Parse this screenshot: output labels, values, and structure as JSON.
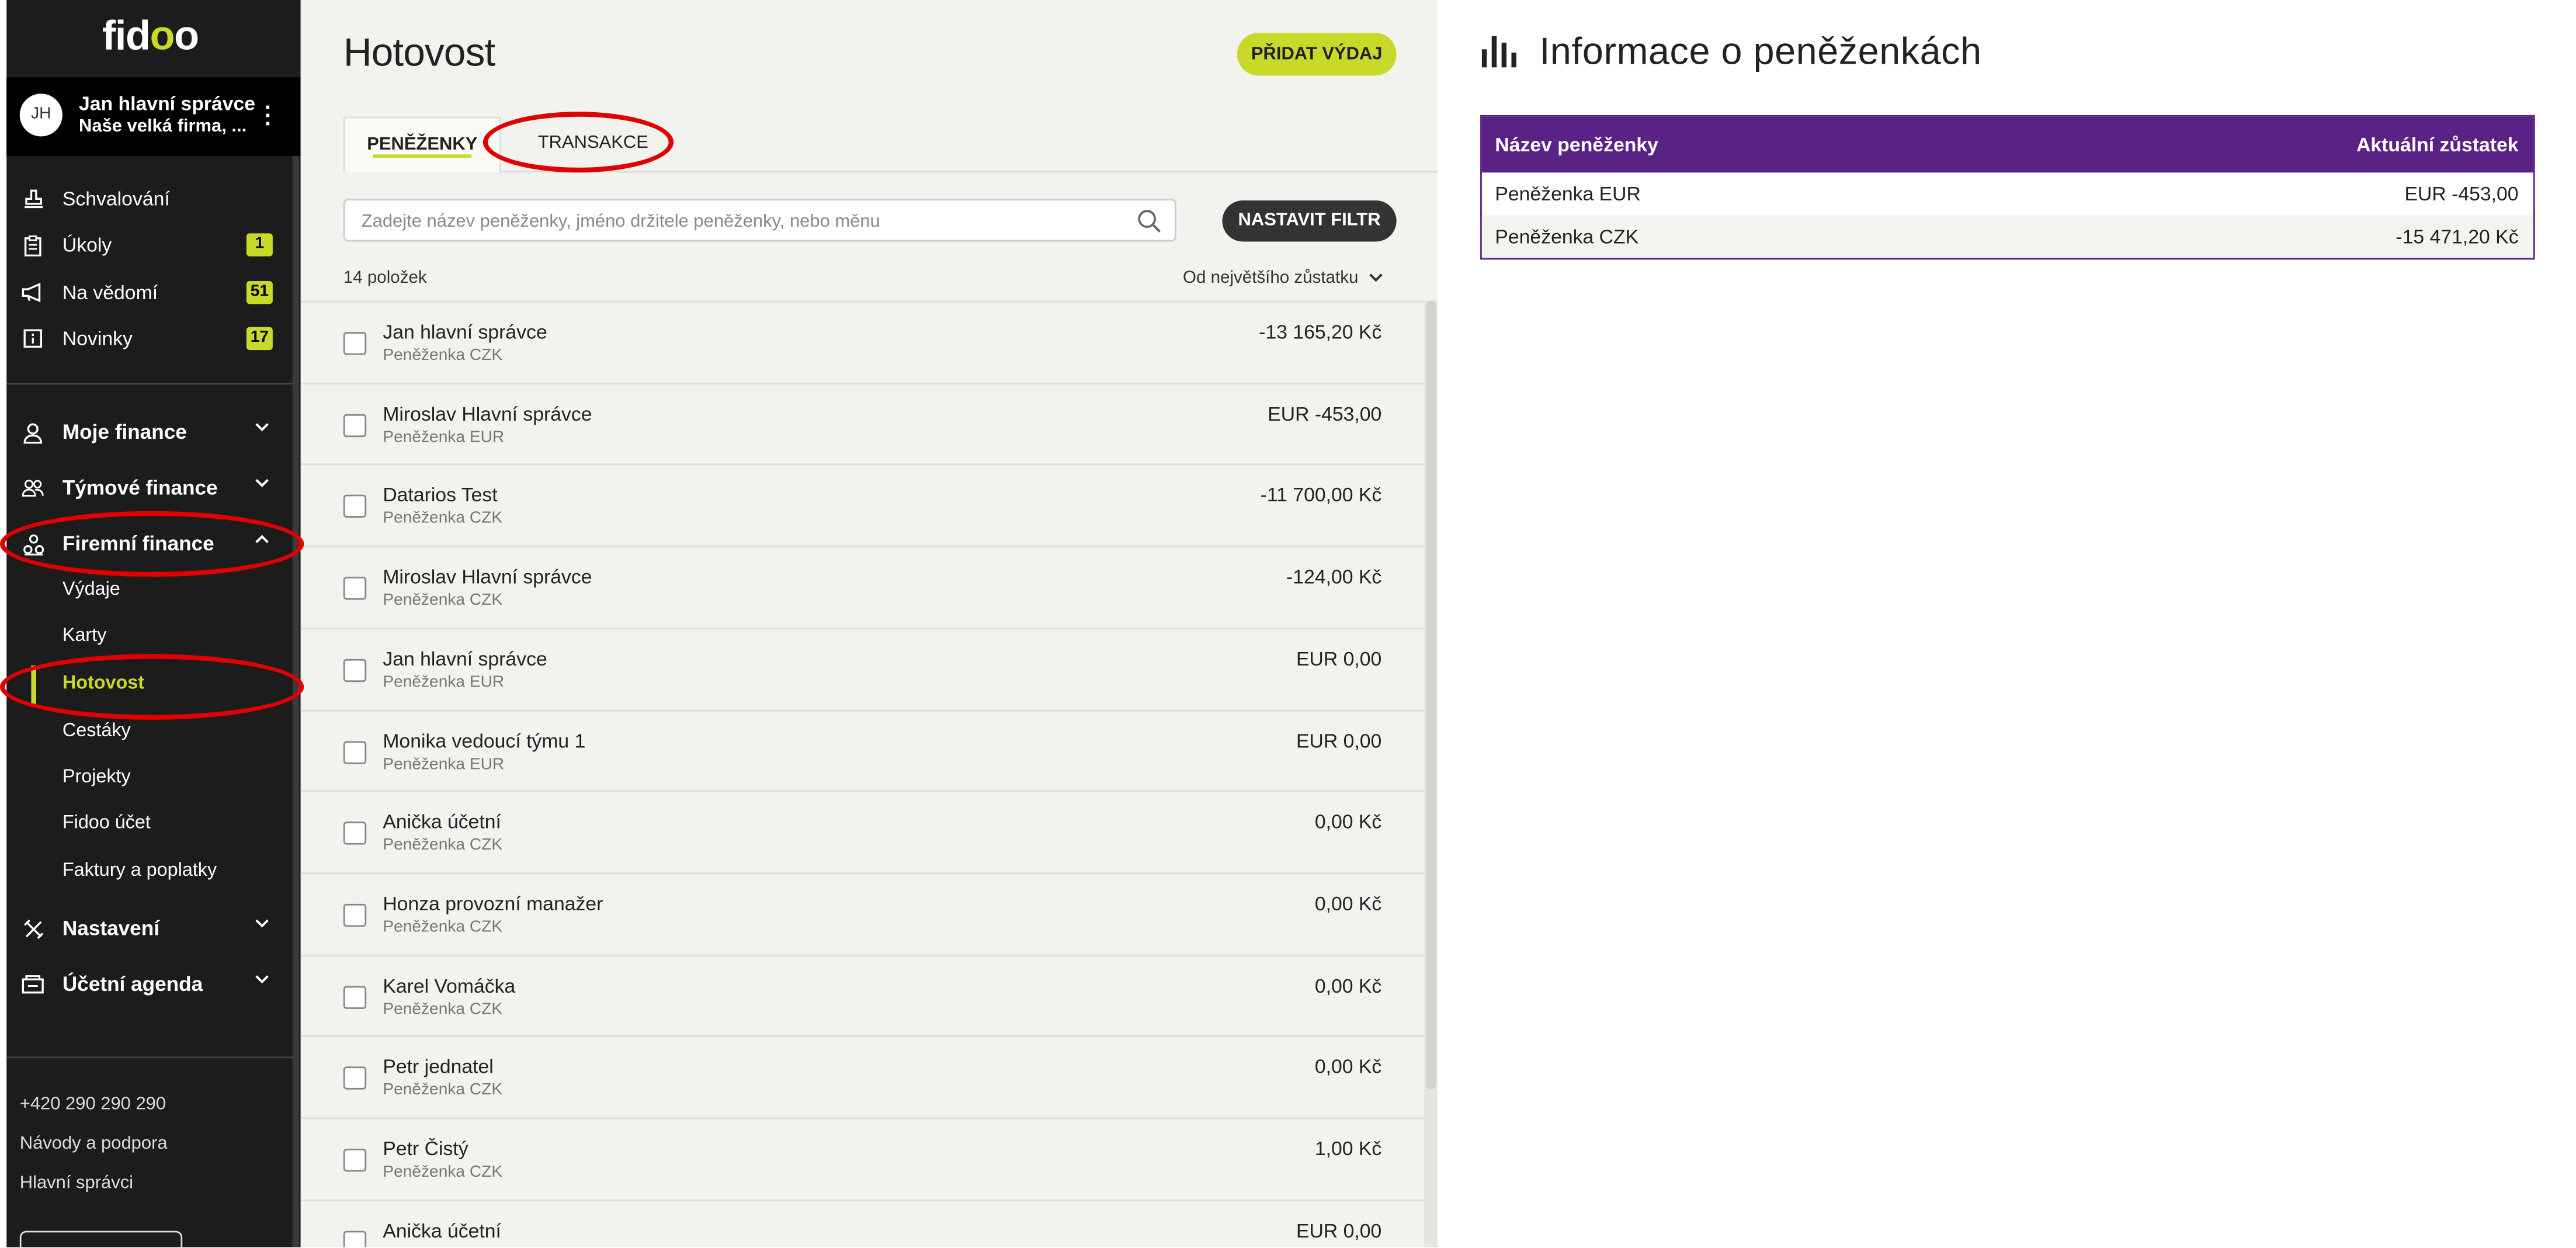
{
  "app": {
    "logo_text_a": "fid",
    "logo_text_b": "o",
    "logo_text_c": "o"
  },
  "user": {
    "initials": "JH",
    "name": "Jan hlavní správce",
    "company": "Naše velká firma, ..."
  },
  "nav": {
    "top_items": [
      {
        "label": "Schvalování",
        "icon": "stamp-icon",
        "badge": ""
      },
      {
        "label": "Úkoly",
        "icon": "clipboard-icon",
        "badge": "1"
      },
      {
        "label": "Na vědomí",
        "icon": "megaphone-icon",
        "badge": "51"
      },
      {
        "label": "Novinky",
        "icon": "news-icon",
        "badge": "17"
      }
    ],
    "sections": [
      {
        "label": "Moje finance",
        "icon": "user-icon",
        "expanded": false
      },
      {
        "label": "Týmové finance",
        "icon": "users-icon",
        "expanded": false
      },
      {
        "label": "Firemní finance",
        "icon": "company-icon",
        "expanded": true
      },
      {
        "label": "Nastavení",
        "icon": "tools-icon",
        "expanded": false
      },
      {
        "label": "Účetní agenda",
        "icon": "accounting-icon",
        "expanded": false
      }
    ],
    "company_sub_items": [
      {
        "label": "Výdaje",
        "active": false
      },
      {
        "label": "Karty",
        "active": false
      },
      {
        "label": "Hotovost",
        "active": true
      },
      {
        "label": "Cestáky",
        "active": false
      },
      {
        "label": "Projekty",
        "active": false
      },
      {
        "label": "Fidoo účet",
        "active": false
      },
      {
        "label": "Faktury a poplatky",
        "active": false
      }
    ],
    "accent_color": "#c9d92a"
  },
  "footer": {
    "phone": "+420 290 290 290",
    "help": "Návody a podpora",
    "admins": "Hlavní správci"
  },
  "main": {
    "title": "Hotovost",
    "add_button": "PŘIDAT VÝDAJ",
    "tabs": [
      {
        "label": "PENĚŽENKY",
        "active": true
      },
      {
        "label": "TRANSAKCE",
        "active": false
      }
    ],
    "search_placeholder": "Zadejte název peněženky, jméno držitele peněženky, nebo měnu",
    "filter_button": "NASTAVIT FILTR",
    "item_count": "14 položek",
    "sort_label": "Od největšího zůstatku",
    "rows": [
      {
        "name": "Jan hlavní správce",
        "wallet": "Peněženka CZK",
        "amount": "-13 165,20 Kč"
      },
      {
        "name": "Miroslav Hlavní správce",
        "wallet": "Peněženka EUR",
        "amount": "EUR -453,00"
      },
      {
        "name": "Datarios Test",
        "wallet": "Peněženka CZK",
        "amount": "-11 700,00 Kč"
      },
      {
        "name": "Miroslav Hlavní správce",
        "wallet": "Peněženka CZK",
        "amount": "-124,00 Kč"
      },
      {
        "name": "Jan hlavní správce",
        "wallet": "Peněženka EUR",
        "amount": "EUR 0,00"
      },
      {
        "name": "Monika vedoucí týmu 1",
        "wallet": "Peněženka EUR",
        "amount": "EUR 0,00"
      },
      {
        "name": "Anička účetní",
        "wallet": "Peněženka CZK",
        "amount": "0,00 Kč"
      },
      {
        "name": "Honza provozní manažer",
        "wallet": "Peněženka CZK",
        "amount": "0,00 Kč"
      },
      {
        "name": "Karel Vomáčka",
        "wallet": "Peněženka CZK",
        "amount": "0,00 Kč"
      },
      {
        "name": "Petr jednatel",
        "wallet": "Peněženka CZK",
        "amount": "0,00 Kč"
      },
      {
        "name": "Petr Čistý",
        "wallet": "Peněženka CZK",
        "amount": "1,00 Kč"
      },
      {
        "name": "Anička účetní",
        "wallet": "",
        "amount": "EUR 0,00"
      }
    ]
  },
  "info_panel": {
    "title": "Informace o peněženkách",
    "icon": "bar-chart-icon",
    "columns": [
      "Název peněženky",
      "Aktuální zůstatek"
    ],
    "rows": [
      {
        "wallet": "Peněženka EUR",
        "balance": "EUR -453,00"
      },
      {
        "wallet": "Peněženka CZK",
        "balance": "-15 471,20 Kč"
      }
    ],
    "header_color": "#5b2286"
  },
  "annotation_color": "#e00000"
}
